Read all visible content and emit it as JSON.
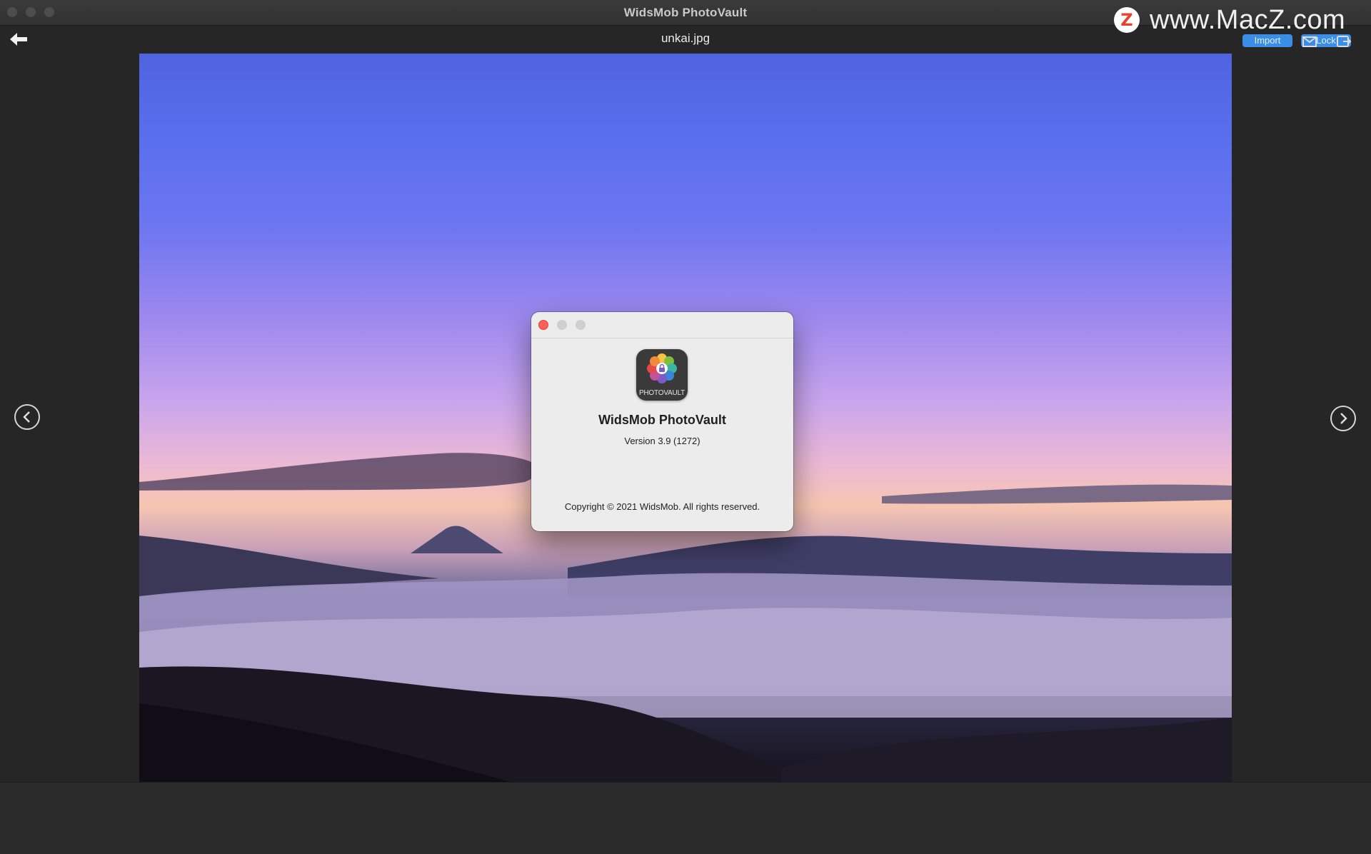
{
  "window": {
    "app_title": "WidsMob PhotoVault"
  },
  "toolbar": {
    "file_name": "unkai.jpg",
    "import_label": "Import",
    "lock_label": "Lock",
    "back_icon": "arrow-left-icon",
    "share_icon": "share-icon",
    "export_icon": "export-icon"
  },
  "watermark": {
    "logo_letter": "Z",
    "text": "www.MacZ.com"
  },
  "viewer": {
    "image_description_icon": "photo",
    "prev_icon": "chevron-left-icon",
    "next_icon": "chevron-right-icon"
  },
  "about_dialog": {
    "icon_label": "PHOTOVAULT",
    "app_name": "WidsMob PhotoVault",
    "version": "Version 3.9 (1272)",
    "copyright": "Copyright © 2021 WidsMob. All rights reserved.",
    "close_color": "#fe5f57",
    "inactive_color": "#cfcfcf"
  },
  "colors": {
    "accent": "#3b8ee6",
    "window_bg": "#262626"
  }
}
